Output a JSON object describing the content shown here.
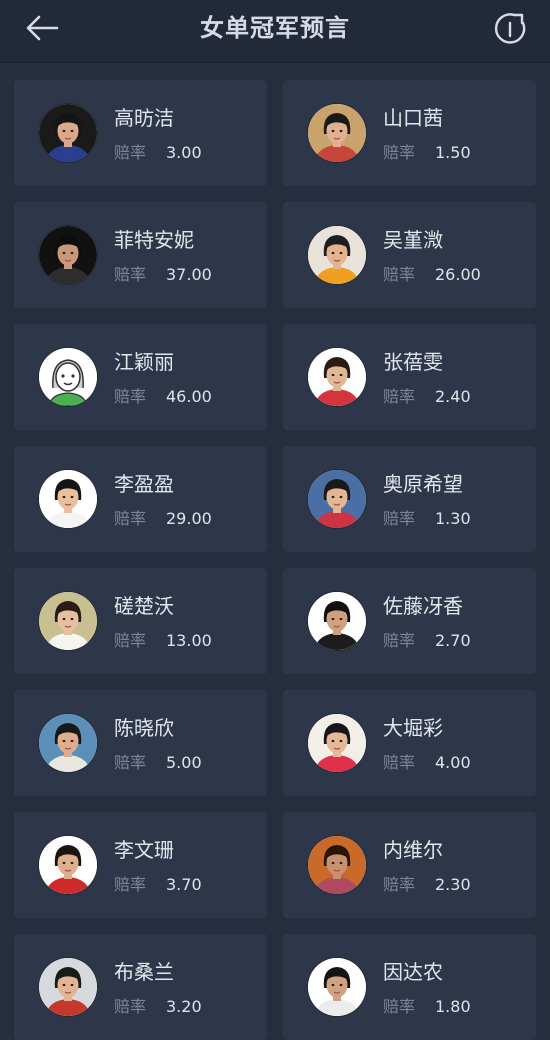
{
  "header": {
    "title": "女单冠军预言",
    "back_icon": "back-arrow-icon",
    "share_icon": "share-icon"
  },
  "odds_label": "赔率",
  "colors": {
    "background": "#252d3e",
    "card": "#2e374a",
    "text_primary": "#e3e6ee",
    "text_secondary": "#7d8598"
  },
  "players": [
    {
      "name": "高昉洁",
      "odds": "3.00"
    },
    {
      "name": "山口茜",
      "odds": "1.50"
    },
    {
      "name": "菲特安妮",
      "odds": "37.00"
    },
    {
      "name": "吴堇溦",
      "odds": "26.00"
    },
    {
      "name": "江颖丽",
      "odds": "46.00"
    },
    {
      "name": "张蓓雯",
      "odds": "2.40"
    },
    {
      "name": "李盈盈",
      "odds": "29.00"
    },
    {
      "name": "奥原希望",
      "odds": "1.30"
    },
    {
      "name": "磋楚沃",
      "odds": "13.00"
    },
    {
      "name": "佐藤冴香",
      "odds": "2.70"
    },
    {
      "name": "陈晓欣",
      "odds": "5.00"
    },
    {
      "name": "大堀彩",
      "odds": "4.00"
    },
    {
      "name": "李文珊",
      "odds": "3.70"
    },
    {
      "name": "内维尔",
      "odds": "2.30"
    },
    {
      "name": "布桑兰",
      "odds": "3.20"
    },
    {
      "name": "因达农",
      "odds": "1.80"
    }
  ]
}
